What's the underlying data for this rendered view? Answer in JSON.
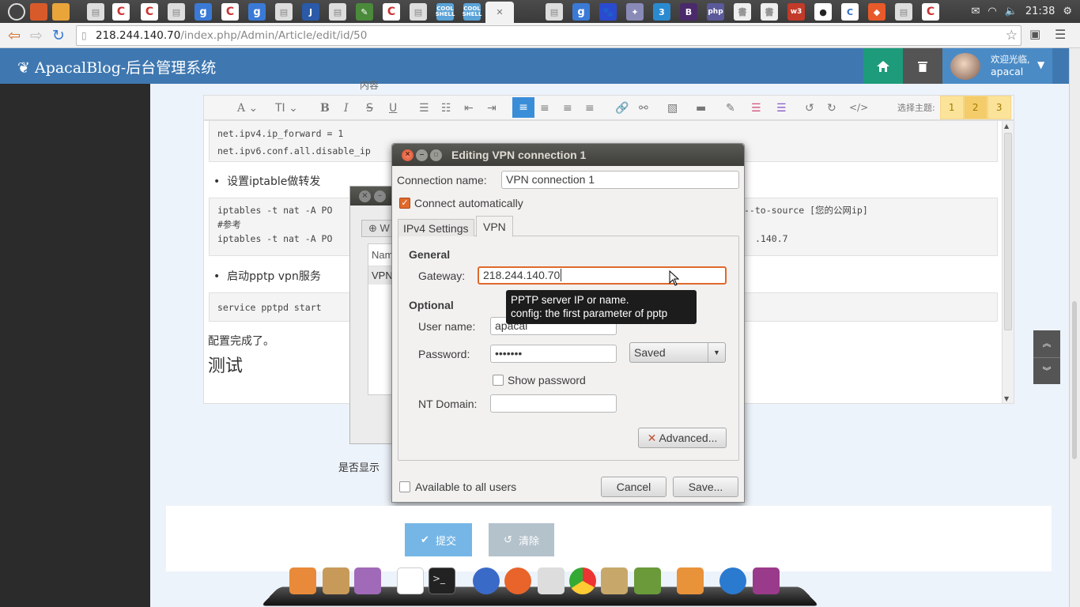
{
  "system_tray": {
    "clock": "21:38"
  },
  "browser": {
    "url_host": "218.244.140.70",
    "url_path": "/index.php/Admin/Article/edit/id/50"
  },
  "app": {
    "brand": "ApacalBlog-后台管理系统",
    "welcome": "欢迎光临,",
    "username": "apacal"
  },
  "editor": {
    "theme_label": "选择主题:",
    "themes": [
      "1",
      "2",
      "3"
    ],
    "partial_label": "内容",
    "code1_lines": [
      "net.ipv4.ip_forward = 1",
      "net.ipv6.conf.all.disable_ip"
    ],
    "bullet1": "设置iptable做转发",
    "code2_lines": [
      "iptables -t nat -A PO",
      "#参考",
      "iptables -t nat -A PO"
    ],
    "code2_right": [
      "--to-source [您的公网ip]",
      "",
      ".140.7"
    ],
    "bullet2": "启动pptp vpn服务",
    "code3_lines": [
      "service pptpd start"
    ],
    "para1": "配置完成了。",
    "para2": "测试"
  },
  "bg_dialog": {
    "tab_partial": "W",
    "col_partial": "Nam",
    "row_partial": "VPN"
  },
  "dialog": {
    "title": "Editing VPN connection 1",
    "conn_name_label": "Connection name:",
    "conn_name_value": "VPN connection 1",
    "auto_connect_label": "Connect automatically",
    "auto_connect_checked": true,
    "tabs": [
      "IPv4 Settings",
      "VPN"
    ],
    "active_tab": "VPN",
    "general_heading": "General",
    "gateway_label": "Gateway:",
    "gateway_value": "218.244.140.70",
    "optional_heading": "Optional",
    "username_label": "User name:",
    "username_value": "apacal",
    "password_label": "Password:",
    "password_value": "•••••••",
    "password_mode": "Saved",
    "show_password_label": "Show password",
    "nt_domain_label": "NT Domain:",
    "nt_domain_value": "",
    "advanced_button": "Advanced...",
    "all_users_label": "Available to all users",
    "cancel_button": "Cancel",
    "save_button": "Save..."
  },
  "tooltip": {
    "line1": "PPTP server IP or name.",
    "line2": "config: the first parameter of pptp"
  },
  "form": {
    "show_label": "是否显示",
    "submit_label": "提交",
    "reset_label": "清除"
  },
  "colors": {
    "header": "#3f78b1",
    "home_button": "#1d9b7a",
    "submit": "#75b6e6",
    "checkbox_accent": "#e06a2c",
    "gateway_focus": "#e0692c"
  }
}
